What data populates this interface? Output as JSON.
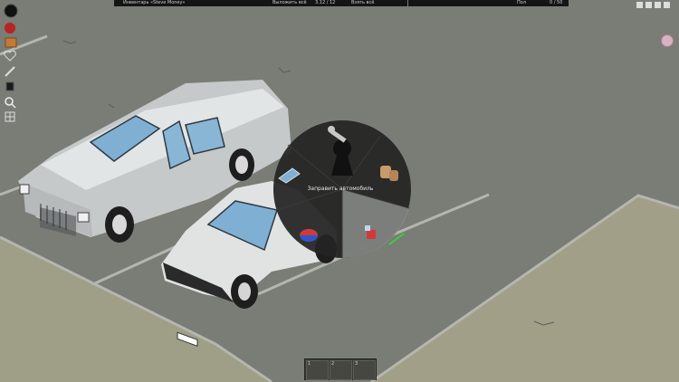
{
  "hud": {
    "top_left_bar": {
      "inventory_title": "Инвентарь «Steve Money»",
      "drop_all": "Выложить всё",
      "weight": "3.12 / 12",
      "take_all": "Взять всё"
    },
    "top_right_bar": {
      "title": "Пол",
      "weight": "0 / 50"
    }
  },
  "left_toolbar": {
    "icons": [
      "health-status-icon",
      "first-aid-icon",
      "crafting-box-icon",
      "heart-icon",
      "map-icon",
      "trash-icon",
      "search-icon",
      "grid-icon"
    ]
  },
  "radial_menu": {
    "center_label": "Заправить автомобиль",
    "segments": [
      "wrench-icon",
      "seat-icon",
      "box-icon",
      "fuel-gauge-icon",
      "window-icon"
    ]
  },
  "hotbar": {
    "slots": [
      {
        "num": "1"
      },
      {
        "num": "2"
      },
      {
        "num": "3"
      }
    ]
  },
  "colors": {
    "ground": "#7a7d76",
    "sand": "#9c9c84",
    "wheel_bg": "#262626",
    "car_light": "#d8dbdb",
    "car_white": "#e6e8e8"
  }
}
